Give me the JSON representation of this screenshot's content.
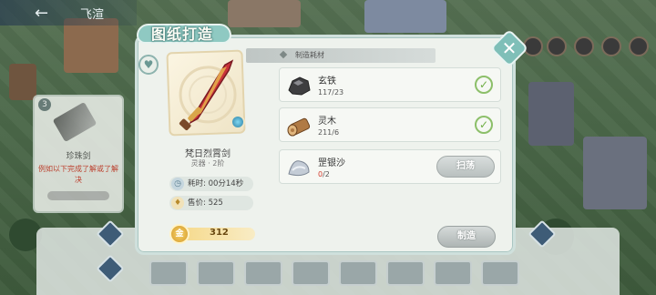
{
  "topbar": {
    "back_glyph": "←",
    "title": "飞渲"
  },
  "left_card": {
    "number": "3",
    "name": "珍珠剑",
    "warning": "例如以下完成了解或了解决"
  },
  "dialog": {
    "title": "图纸打造",
    "item_name": "梵日烈霄剑",
    "item_subtitle": "灵器 · 2阶",
    "time_label": "耗时: 00分14秒",
    "price_label": "售价: 525",
    "cost_value": "312",
    "cost_icon_label": "金",
    "materials_header": "制造耗材",
    "materials": [
      {
        "name": "玄铁",
        "count": "117/23",
        "status": "enough",
        "icon": "black-iron-ore-icon",
        "color": "#4a4a4a"
      },
      {
        "name": "灵木",
        "count": "211/6",
        "status": "enough",
        "icon": "spirit-wood-log-icon",
        "color": "#b07a44"
      },
      {
        "name": "罡银沙",
        "count_have": "0",
        "count_need": "/2",
        "status": "lacking",
        "icon": "silver-sand-icon",
        "color": "#c4ccd6"
      }
    ],
    "sweep_button": "扫荡",
    "make_button": "制造",
    "check_glyph": "✓",
    "close_glyph": "✕",
    "heart_glyph": "♥"
  },
  "colors": {
    "accent_teal": "#7fbfb8",
    "ok_green": "#6fae44",
    "lack_red": "#d23b2c",
    "gold": "#d49a2b"
  }
}
